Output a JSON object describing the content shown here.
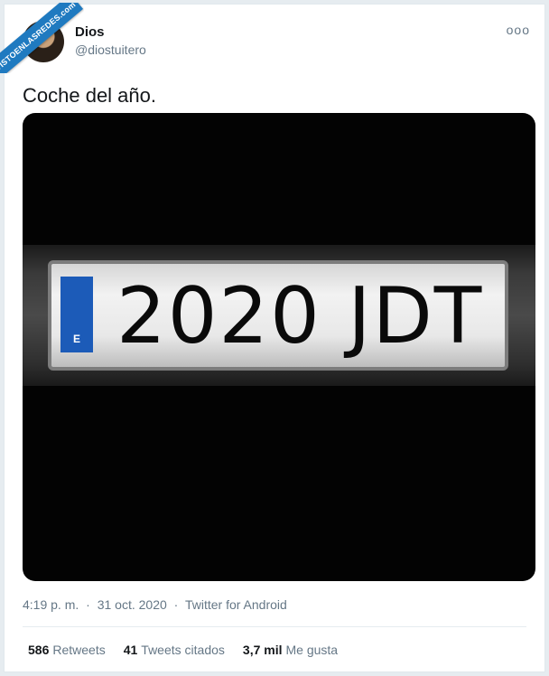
{
  "watermark": {
    "text": "VISTOENLASREDES.com"
  },
  "author": {
    "name": "Dios",
    "handle": "@diostuitero"
  },
  "more_icon": "ooo",
  "tweet": {
    "text": "Coche del año."
  },
  "media": {
    "alt": "license-plate-photo",
    "plate_country": "E",
    "plate_number": "2020 JDT"
  },
  "meta": {
    "time": "4:19 p. m.",
    "date": "31 oct. 2020",
    "source": "Twitter for Android",
    "separator": "·"
  },
  "stats": {
    "retweets": {
      "count": "586",
      "label": "Retweets"
    },
    "quotes": {
      "count": "41",
      "label": "Tweets citados"
    },
    "likes": {
      "count": "3,7 mil",
      "label": "Me gusta"
    }
  }
}
